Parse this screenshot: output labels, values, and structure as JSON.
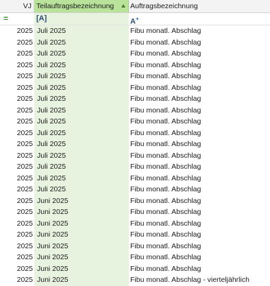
{
  "columns": {
    "vj": "VJ",
    "teil": "Teilauftragsbezeichnung",
    "auf": "Auftragsbezeichnung"
  },
  "filter_row": {
    "vj_icon": "=",
    "teil_icon": "[A]",
    "auf_icon": "A",
    "auf_icon_sup": "+"
  },
  "rows": [
    {
      "vj": "2025",
      "teil": "Juli 2025",
      "auf": "Fibu monatl. Abschlag"
    },
    {
      "vj": "2025",
      "teil": "Juli 2025",
      "auf": "Fibu monatl. Abschlag"
    },
    {
      "vj": "2025",
      "teil": "Juli 2025",
      "auf": "Fibu monatl. Abschlag"
    },
    {
      "vj": "2025",
      "teil": "Juli 2025",
      "auf": "Fibu monatl. Abschlag"
    },
    {
      "vj": "2025",
      "teil": "Juli 2025",
      "auf": "Fibu monatl. Abschlag"
    },
    {
      "vj": "2025",
      "teil": "Juli 2025",
      "auf": "Fibu monatl. Abschlag"
    },
    {
      "vj": "2025",
      "teil": "Juli 2025",
      "auf": "Fibu monatl. Abschlag"
    },
    {
      "vj": "2025",
      "teil": "Juli 2025",
      "auf": "Fibu monatl. Abschlag"
    },
    {
      "vj": "2025",
      "teil": "Juli 2025",
      "auf": "Fibu monatl. Abschlag"
    },
    {
      "vj": "2025",
      "teil": "Juli 2025",
      "auf": "Fibu monatl. Abschlag"
    },
    {
      "vj": "2025",
      "teil": "Juli 2025",
      "auf": "Fibu monatl. Abschlag"
    },
    {
      "vj": "2025",
      "teil": "Juli 2025",
      "auf": "Fibu monatl. Abschlag"
    },
    {
      "vj": "2025",
      "teil": "Juli 2025",
      "auf": "Fibu monatl. Abschlag"
    },
    {
      "vj": "2025",
      "teil": "Juli 2025",
      "auf": "Fibu monatl. Abschlag"
    },
    {
      "vj": "2025",
      "teil": "Juli 2025",
      "auf": "Fibu monatl. Abschlag"
    },
    {
      "vj": "2025",
      "teil": "Juni 2025",
      "auf": "Fibu monatl. Abschlag"
    },
    {
      "vj": "2025",
      "teil": "Juni 2025",
      "auf": "Fibu monatl. Abschlag"
    },
    {
      "vj": "2025",
      "teil": "Juni 2025",
      "auf": "Fibu monatl. Abschlag"
    },
    {
      "vj": "2025",
      "teil": "Juni 2025",
      "auf": "Fibu monatl. Abschlag"
    },
    {
      "vj": "2025",
      "teil": "Juni 2025",
      "auf": "Fibu monatl. Abschlag"
    },
    {
      "vj": "2025",
      "teil": "Juni 2025",
      "auf": "Fibu monatl. Abschlag"
    },
    {
      "vj": "2025",
      "teil": "Juni 2025",
      "auf": "Fibu monatl. Abschlag"
    },
    {
      "vj": "2025",
      "teil": "Juni 2025",
      "auf": "Fibu monatl. Abschlag - vierteljährlich"
    }
  ]
}
